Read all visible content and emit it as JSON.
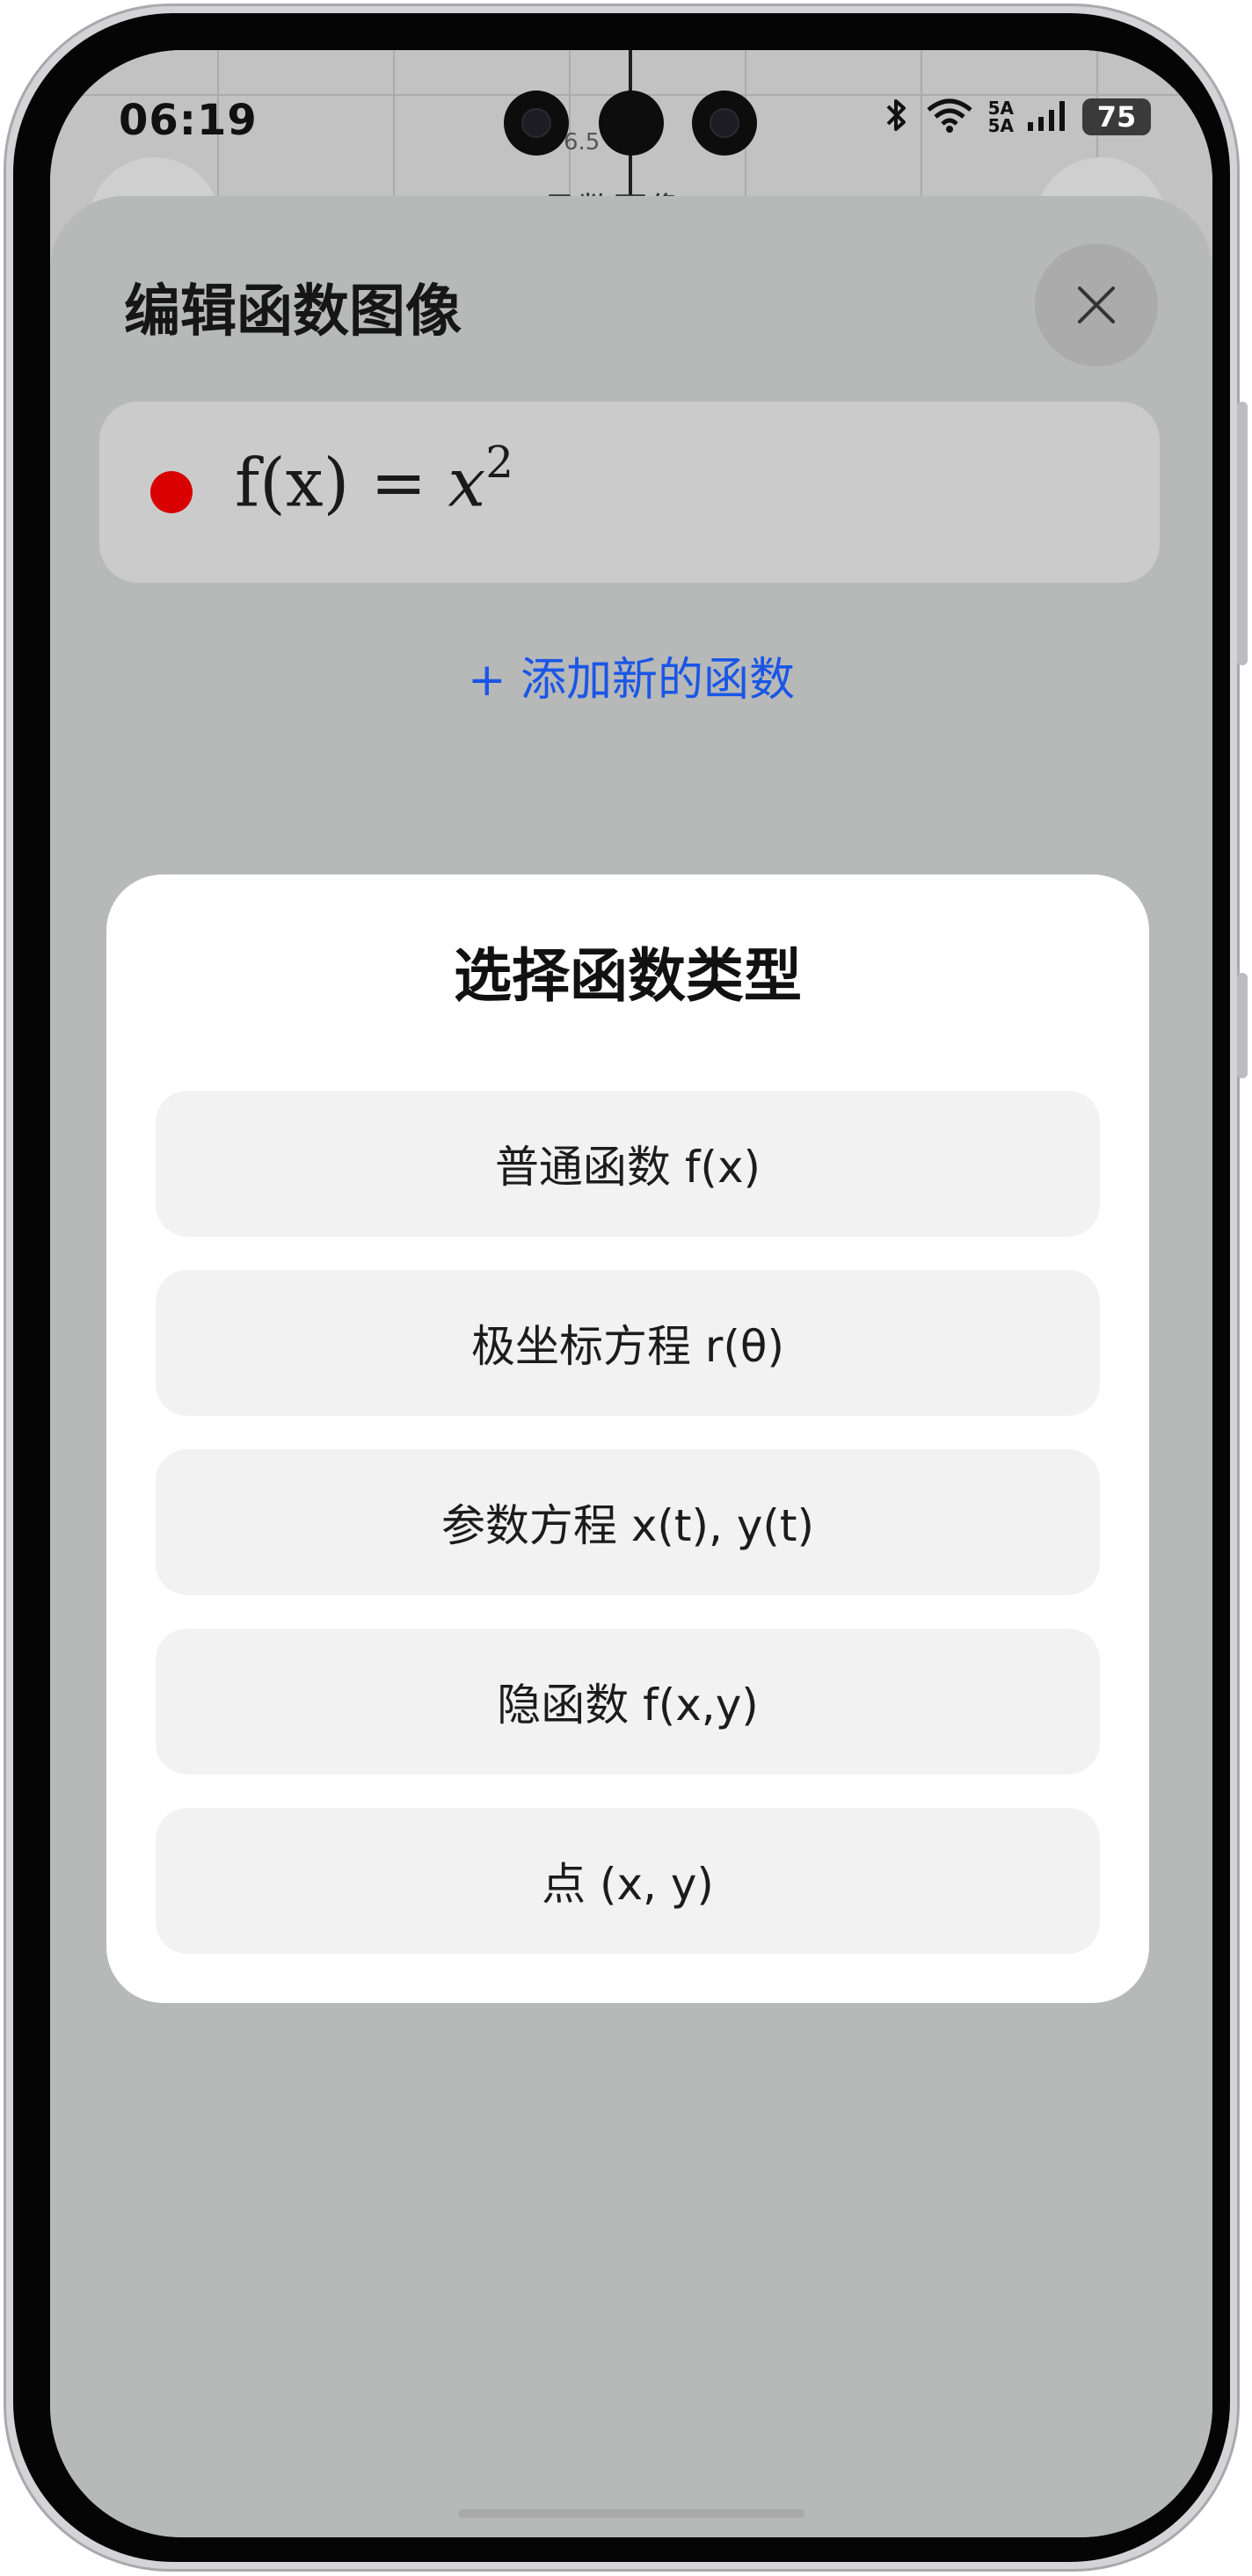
{
  "status_bar": {
    "time": "06:19",
    "signal_top": "5A",
    "signal_bottom": "5A",
    "battery": "75"
  },
  "background_app": {
    "axis_tick": "6.5",
    "title": "函数图像"
  },
  "editor": {
    "title": "编辑函数图像",
    "function": {
      "color": "#d80000",
      "lhs": "f(x) =",
      "variable": "x",
      "exponent": "2"
    },
    "add_link": "+ 添加新的函数"
  },
  "type_dialog": {
    "title": "选择函数类型",
    "options": [
      {
        "label": "普通函数 f(x)"
      },
      {
        "label": "极坐标方程 r(θ)"
      },
      {
        "label": "参数方程 x(t), y(t)"
      },
      {
        "label": "隐函数 f(x,y)"
      },
      {
        "label": "点 (x, y)"
      }
    ]
  },
  "colors": {
    "accent_link": "#1a56e6",
    "function_dot": "#d80000",
    "overlay_bg": "#b7b8b8"
  }
}
